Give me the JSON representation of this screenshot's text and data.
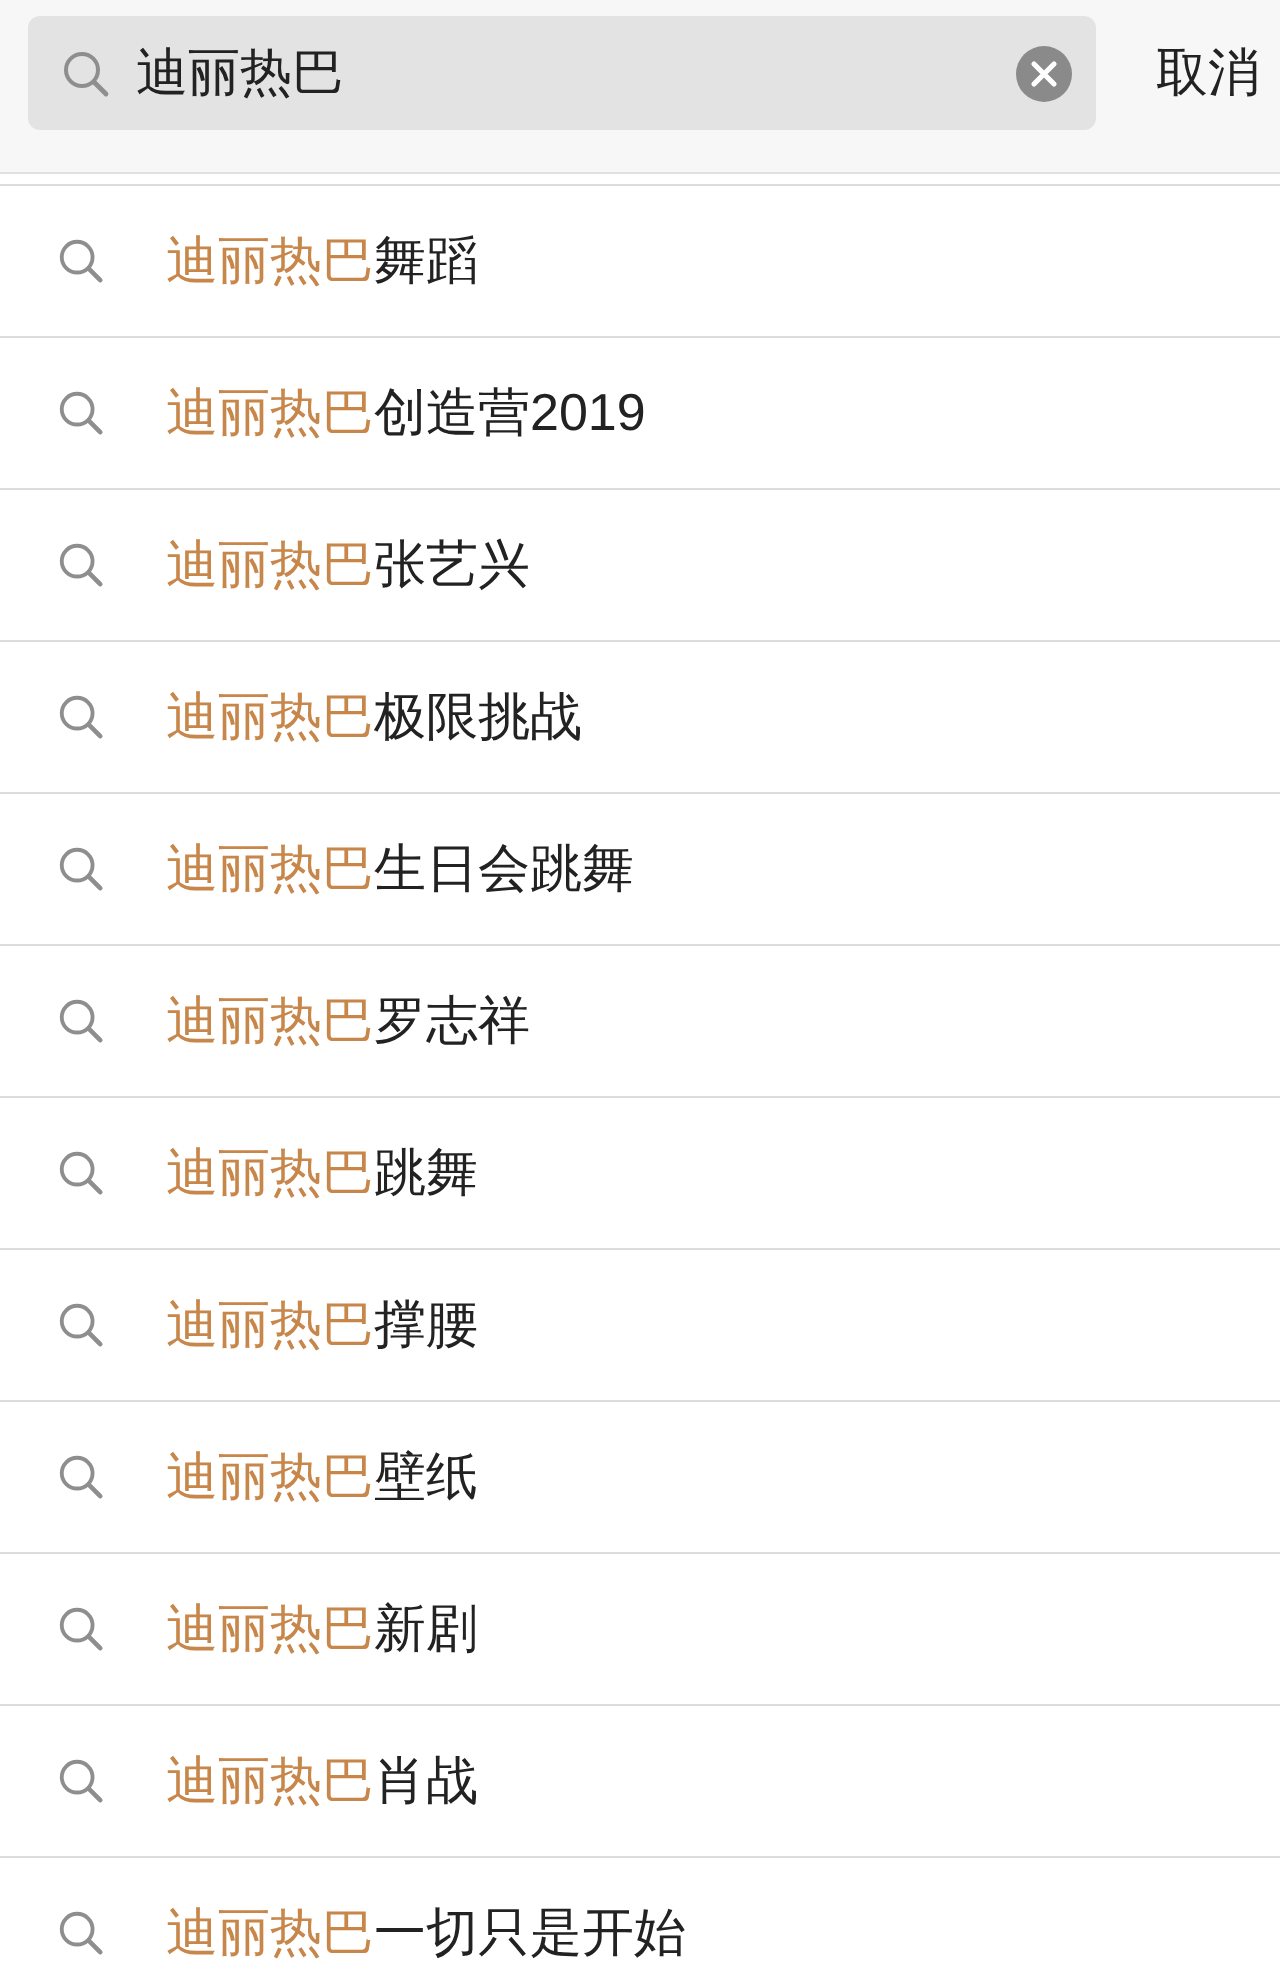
{
  "search": {
    "value": "迪丽热巴",
    "cancel": "取消"
  },
  "suggestions": [
    {
      "match": "迪丽热巴",
      "rest": "舞蹈"
    },
    {
      "match": "迪丽热巴",
      "rest": "创造营2019"
    },
    {
      "match": "迪丽热巴",
      "rest": "张艺兴"
    },
    {
      "match": "迪丽热巴",
      "rest": "极限挑战"
    },
    {
      "match": "迪丽热巴",
      "rest": "生日会跳舞"
    },
    {
      "match": "迪丽热巴",
      "rest": "罗志祥"
    },
    {
      "match": "迪丽热巴",
      "rest": "跳舞"
    },
    {
      "match": "迪丽热巴",
      "rest": "撑腰"
    },
    {
      "match": "迪丽热巴",
      "rest": "壁纸"
    },
    {
      "match": "迪丽热巴",
      "rest": "新剧"
    },
    {
      "match": "迪丽热巴",
      "rest": "肖战"
    },
    {
      "match": "迪丽热巴",
      "rest": "一切只是开始"
    }
  ]
}
